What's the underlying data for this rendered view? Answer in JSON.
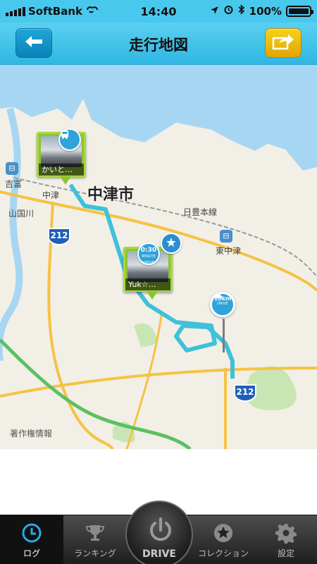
{
  "status_bar": {
    "carrier": "SoftBank",
    "time": "14:40",
    "battery": "100%"
  },
  "nav": {
    "title": "走行地図",
    "back_icon": "back-arrow-icon",
    "share_icon": "share-icon"
  },
  "map": {
    "city": "中津市",
    "labels": [
      "吉富",
      "山国川",
      "日豊本線",
      "東中津",
      "中津"
    ],
    "route_numbers": [
      "212",
      "212"
    ],
    "copyright": "著作権情報",
    "pins": [
      {
        "caption": "かいと…",
        "icon": "bus-icon"
      },
      {
        "caption": "Yuk☆…",
        "badge_top": "0:30",
        "badge_mid": "MINUTE",
        "badge_bot": "DRIVE"
      }
    ],
    "distance_marker": {
      "value": "10km",
      "unit": "DRIVE"
    },
    "colors": {
      "route": "#3ec1d9",
      "water": "#a7d6f2",
      "land": "#f2efe7",
      "road": "#f6c244"
    }
  },
  "tabs": [
    {
      "label": "ログ",
      "icon": "clock-icon"
    },
    {
      "label": "ランキング",
      "icon": "trophy-icon"
    },
    {
      "label": "DRIVE",
      "icon": "power-icon"
    },
    {
      "label": "コレクション",
      "icon": "star-icon"
    },
    {
      "label": "設定",
      "icon": "gear-icon"
    }
  ]
}
